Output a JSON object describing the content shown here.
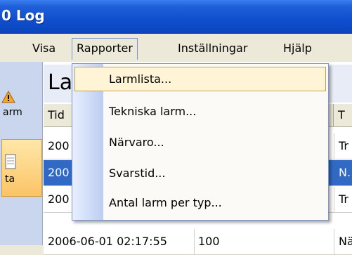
{
  "window": {
    "title": "0 Log"
  },
  "menubar": {
    "items": [
      {
        "label": "Visa"
      },
      {
        "label": "Rapporter"
      },
      {
        "label": "Inställningar"
      },
      {
        "label": "Hjälp"
      }
    ]
  },
  "sidebar": {
    "items": [
      {
        "label": "arm"
      },
      {
        "label": "ta"
      }
    ]
  },
  "panel": {
    "heading": "La"
  },
  "grid": {
    "headers": [
      "Tid",
      "",
      "T"
    ],
    "rows": [
      {
        "c1": "200",
        "c2": "",
        "c3": "Tr",
        "selected": false
      },
      {
        "c1": "200",
        "c2": "",
        "c3": "N.",
        "selected": true
      },
      {
        "c1": "200",
        "c2": "",
        "c3": "Tr",
        "selected": false
      },
      {
        "c1": "2006-06-01 02:17:55",
        "c2": "100",
        "c3": "Nä",
        "selected": false
      }
    ]
  },
  "dropdown": {
    "items": [
      {
        "label": "Larmlista..."
      },
      {
        "label": "Tekniska larm..."
      },
      {
        "label": "Närvaro..."
      },
      {
        "label": "Svarstid..."
      },
      {
        "label": "Antal larm per typ..."
      }
    ]
  },
  "colors": {
    "titlebar": "#0f4fcf",
    "selection": "#316ac5",
    "menu_hover": "#fff5d6"
  }
}
